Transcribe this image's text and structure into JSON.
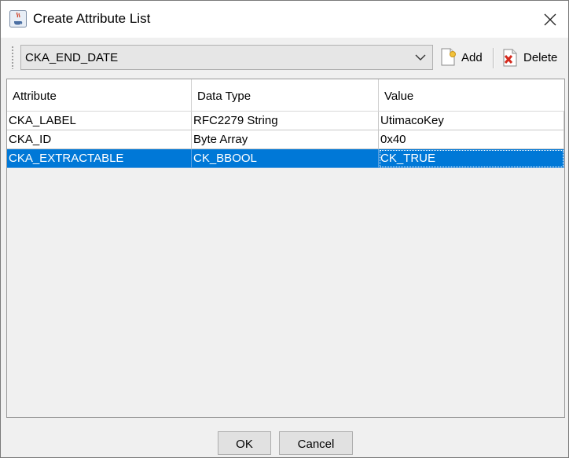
{
  "window": {
    "title": "Create Attribute List",
    "icon": "java-coffee-icon"
  },
  "toolbar": {
    "selected_attribute": "CKA_END_DATE",
    "add_label": "Add",
    "delete_label": "Delete",
    "add_icon": "add-document-icon",
    "delete_icon": "delete-document-icon"
  },
  "table": {
    "columns": [
      "Attribute",
      "Data Type",
      "Value"
    ],
    "rows": [
      {
        "attribute": "CKA_LABEL",
        "data_type": "RFC2279 String",
        "value": "UtimacoKey",
        "selected": false
      },
      {
        "attribute": "CKA_ID",
        "data_type": "Byte Array",
        "value": "0x40",
        "selected": false
      },
      {
        "attribute": "CKA_EXTRACTABLE",
        "data_type": "CK_BBOOL",
        "value": "CK_TRUE",
        "selected": true
      }
    ]
  },
  "buttons": {
    "ok_label": "OK",
    "cancel_label": "Cancel"
  },
  "colors": {
    "selection": "#0078d7",
    "dialog_background": "#f0f0f0"
  }
}
